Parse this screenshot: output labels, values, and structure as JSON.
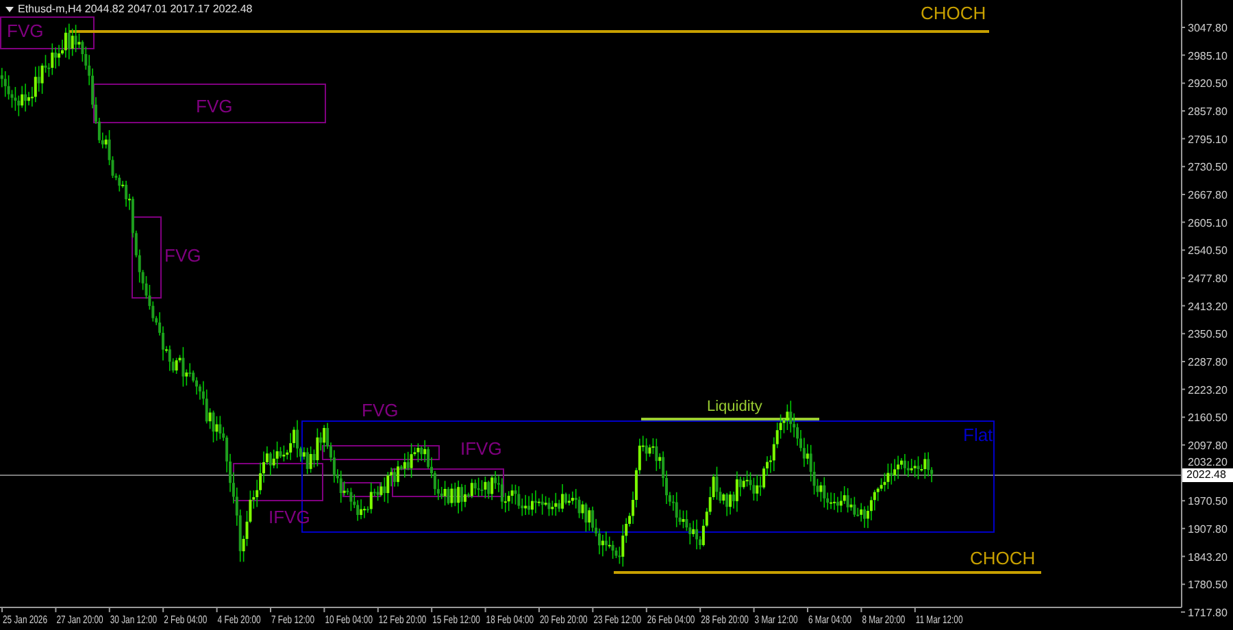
{
  "chart": {
    "symbol_info": "Ethusd-m,H4  2044.82 2047.01 2017.17 2022.48",
    "price_labels": [
      "3047.80",
      "2985.10",
      "2920.50",
      "2857.80",
      "2795.10",
      "2730.50",
      "2667.80",
      "2605.10",
      "2540.50",
      "2477.80",
      "2413.20",
      "2350.50",
      "2287.80",
      "2223.20",
      "2160.50",
      "2097.80",
      "2032.20",
      "1970.50",
      "1907.80",
      "1843.20",
      "1780.50",
      "1717.80"
    ],
    "current_price": "2022.48",
    "time_labels": [
      "25 Jan 2026",
      "27 Jan 20:00",
      "30 Jan 12:00",
      "2 Feb 04:00",
      "4 Feb 20:00",
      "7 Feb 12:00",
      "10 Feb 04:00",
      "12 Feb 20:00",
      "15 Feb 12:00",
      "18 Feb 04:00",
      "20 Feb 20:00",
      "23 Feb 12:00",
      "26 Feb 04:00",
      "28 Feb 20:00",
      "3 Mar 12:00",
      "6 Mar 04:00",
      "8 Mar 20:00",
      "11 Mar 12:00"
    ],
    "annotations": [
      {
        "kind": "zone",
        "label": "FVG",
        "color": "#800080"
      },
      {
        "kind": "line",
        "label": "CHOCH",
        "color": "#c8a000"
      },
      {
        "kind": "zone",
        "label": "FVG",
        "color": "#800080"
      },
      {
        "kind": "zone",
        "label": "FVG",
        "color": "#800080"
      },
      {
        "kind": "range",
        "label": "Flat",
        "color": "#0000c8"
      },
      {
        "kind": "zone",
        "label": "FVG",
        "color": "#800080"
      },
      {
        "kind": "zone",
        "label": "IFVG",
        "color": "#800080"
      },
      {
        "kind": "zone",
        "color": "#800080"
      },
      {
        "kind": "zone",
        "label": "IFVG",
        "color": "#800080"
      },
      {
        "kind": "line",
        "label": "Liquidity",
        "color": "#9acd32"
      },
      {
        "kind": "line",
        "label": "CHOCH",
        "color": "#c8a000"
      }
    ]
  }
}
